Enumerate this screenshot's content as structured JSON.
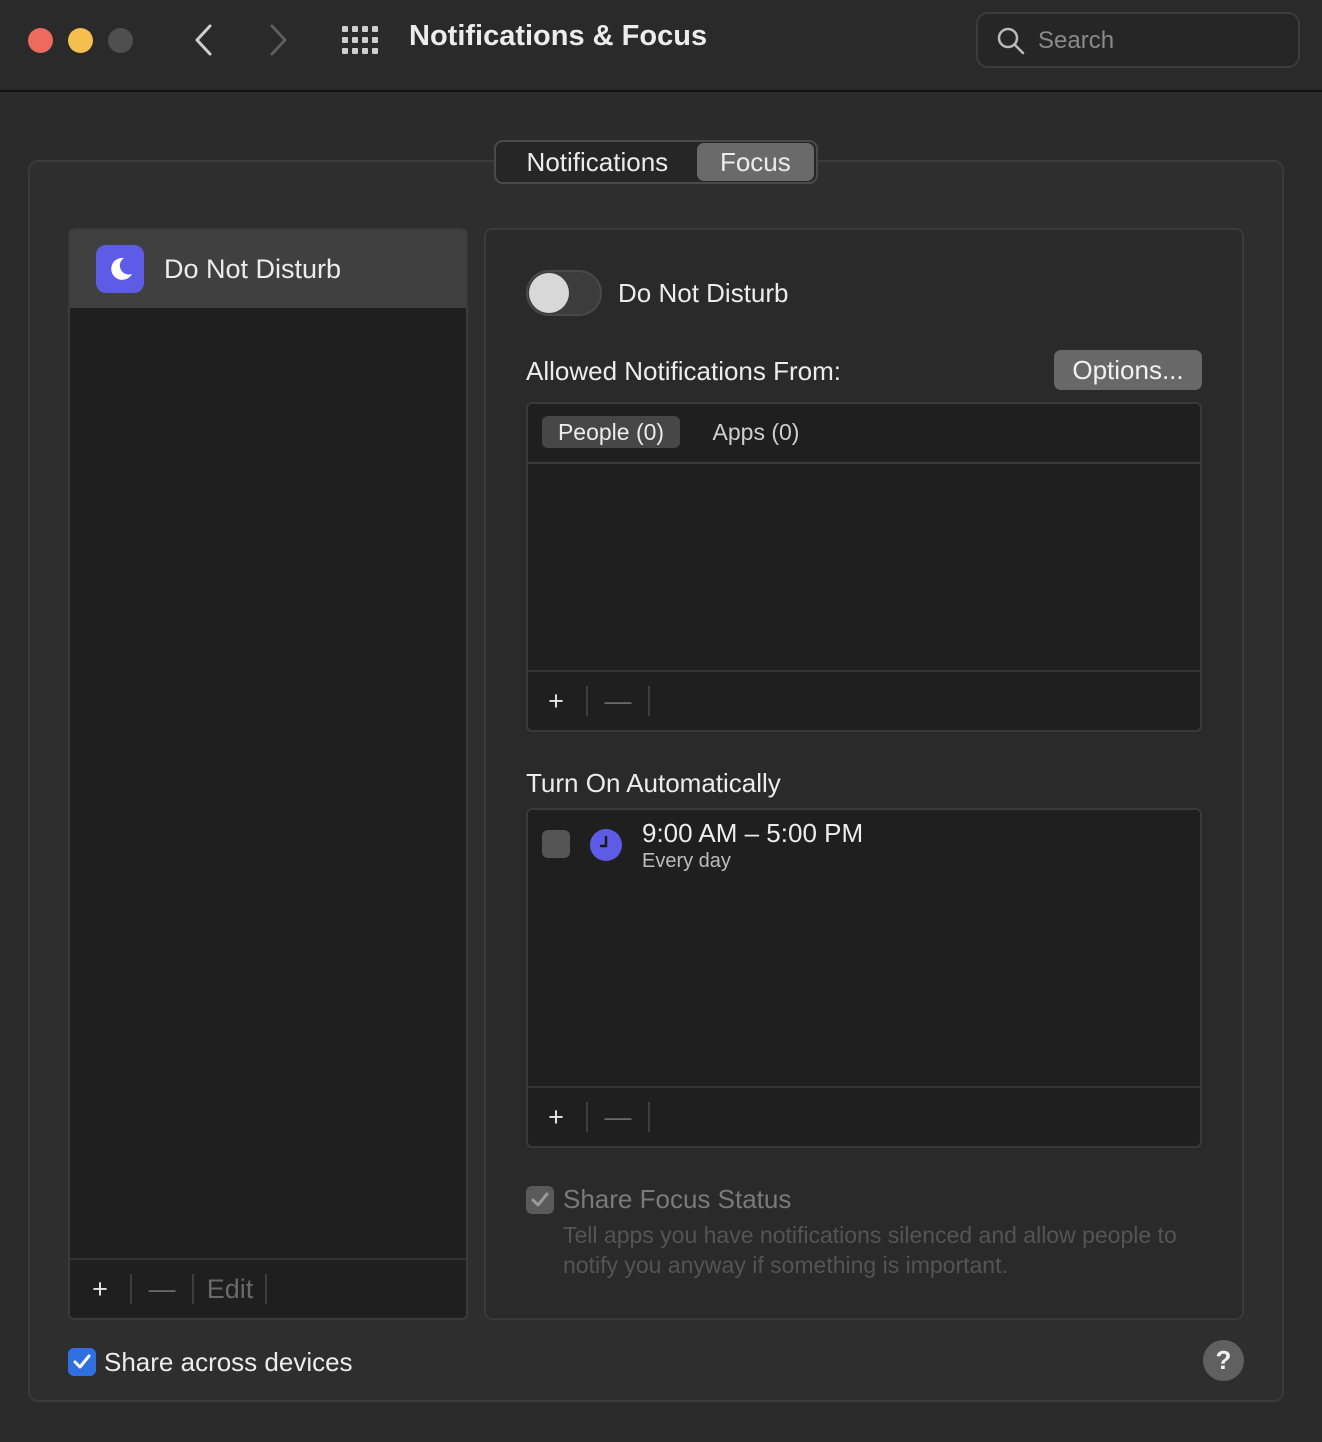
{
  "window": {
    "title": "Notifications & Focus",
    "search_placeholder": "Search"
  },
  "tabs": {
    "notifications": "Notifications",
    "focus": "Focus",
    "selected": "Focus"
  },
  "focus_list": {
    "items": [
      {
        "label": "Do Not Disturb",
        "icon": "moon-icon",
        "selected": true
      }
    ],
    "add": "+",
    "remove": "—",
    "edit": "Edit"
  },
  "detail": {
    "toggle_label": "Do Not Disturb",
    "toggle_on": false,
    "allowed_label": "Allowed Notifications From:",
    "options_button": "Options...",
    "allowed_tabs": {
      "people": "People (0)",
      "apps": "Apps (0)",
      "selected": "People (0)"
    },
    "allowed_add": "+",
    "allowed_remove": "—",
    "turn_on_label": "Turn On Automatically",
    "schedule": {
      "time": "9:00 AM – 5:00 PM",
      "repeat": "Every day",
      "enabled": false,
      "icon": "clock-icon"
    },
    "schedule_add": "+",
    "schedule_remove": "—",
    "share_focus": {
      "label": "Share Focus Status",
      "description": "Tell apps you have notifications silenced and allow people to notify you anyway if something is important.",
      "checked": true,
      "disabled": true
    }
  },
  "share_across_devices": {
    "label": "Share across devices",
    "checked": true
  },
  "help": "?",
  "colors": {
    "close": "#ed6a5e",
    "minimize": "#f4bf4f",
    "accent": "#5e5ce6",
    "checkbox_blue": "#2f6fe0"
  }
}
